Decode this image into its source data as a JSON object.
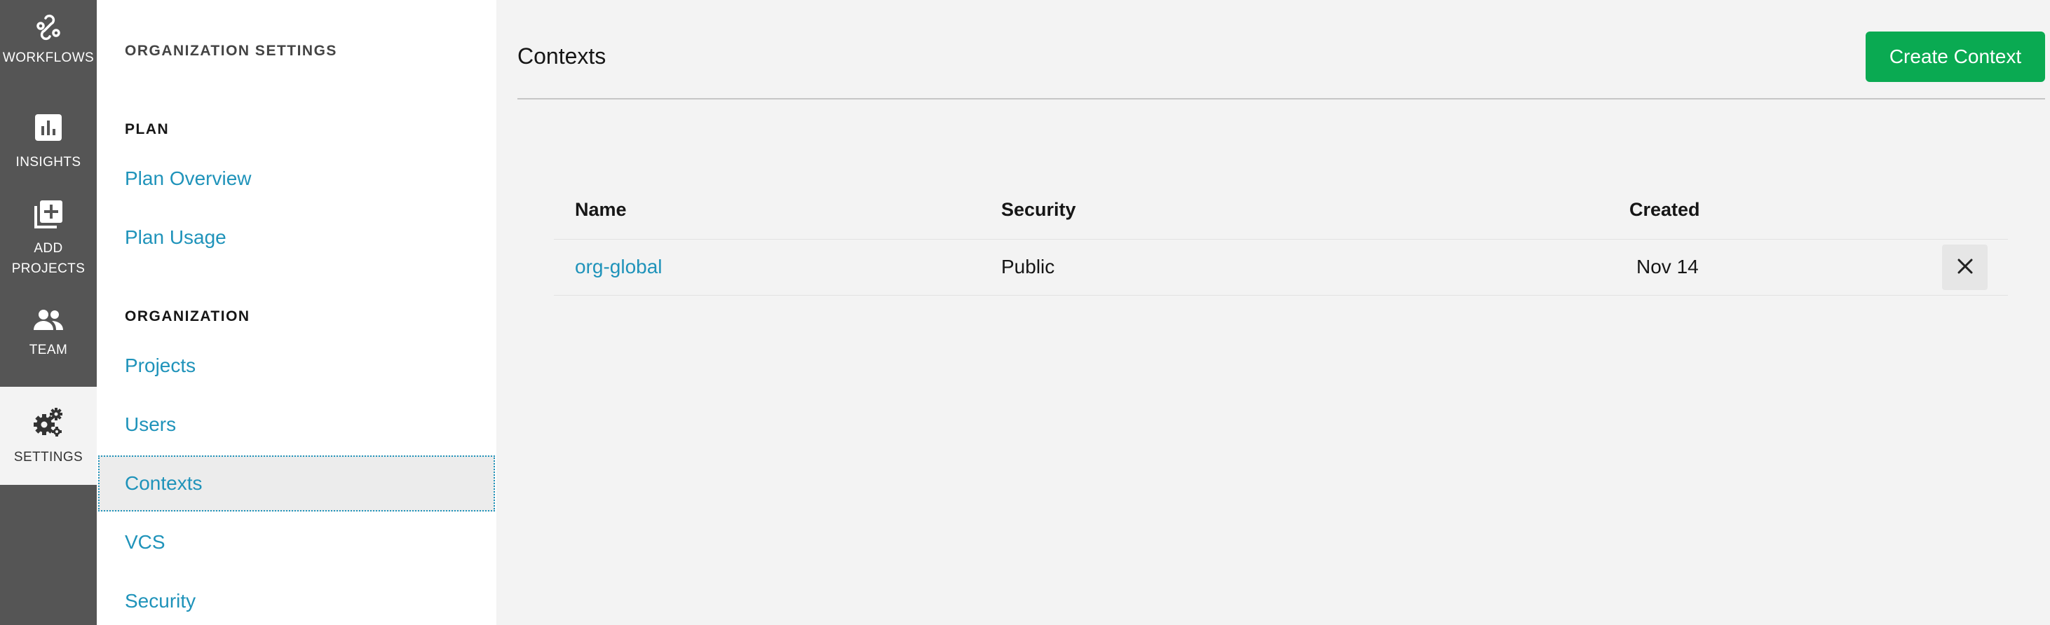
{
  "rail": {
    "items": [
      {
        "label": "WORKFLOWS",
        "icon": "workflows-icon"
      },
      {
        "label": "INSIGHTS",
        "icon": "insights-icon"
      },
      {
        "label_line1": "ADD",
        "label_line2": "PROJECTS",
        "icon": "add-projects-icon"
      },
      {
        "label": "TEAM",
        "icon": "team-icon"
      },
      {
        "label": "SETTINGS",
        "icon": "settings-gears-icon"
      }
    ]
  },
  "nav": {
    "title": "ORGANIZATION SETTINGS",
    "sections": [
      {
        "heading": "PLAN",
        "links": [
          "Plan Overview",
          "Plan Usage"
        ]
      },
      {
        "heading": "ORGANIZATION",
        "links": [
          "Projects",
          "Users",
          "Contexts",
          "VCS",
          "Security"
        ]
      }
    ],
    "active": "Contexts"
  },
  "main": {
    "title": "Contexts",
    "create_button": "Create Context",
    "table": {
      "headers": [
        "Name",
        "Security",
        "Created"
      ],
      "rows": [
        {
          "name": "org-global",
          "security": "Public",
          "created": "Nov 14"
        }
      ]
    }
  },
  "colors": {
    "rail_bg": "#555555",
    "link": "#1f93ba",
    "primary_button": "#0aaa52"
  }
}
